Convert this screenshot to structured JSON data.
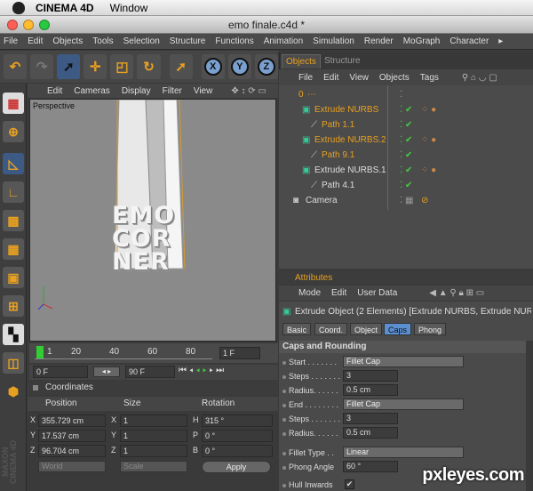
{
  "mac_menu": {
    "app": "CINEMA 4D",
    "items": [
      "Window"
    ]
  },
  "window": {
    "title": "emo finale.c4d *"
  },
  "main_menu": [
    "File",
    "Edit",
    "Objects",
    "Tools",
    "Selection",
    "Structure",
    "Functions",
    "Animation",
    "Simulation",
    "Render",
    "MoGraph",
    "Character"
  ],
  "toolbar": {
    "axis_x": "X",
    "axis_y": "Y",
    "axis_z": "Z"
  },
  "viewport_menu": [
    "Edit",
    "Cameras",
    "Display",
    "Filter",
    "View"
  ],
  "viewport": {
    "label": "Perspective",
    "text_lines": [
      "EMO",
      "COR",
      "NER"
    ]
  },
  "timeline": {
    "ticks": [
      "1",
      "20",
      "40",
      "60",
      "80"
    ],
    "frame_field": "1 F"
  },
  "time_controls": {
    "start": "0 F",
    "end": "90 F"
  },
  "coordinates": {
    "title": "Coordinates",
    "col_position": "Position",
    "col_size": "Size",
    "col_rotation": "Rotation",
    "rows": [
      {
        "axis": "X",
        "pos": "355.729 cm",
        "size_axis": "X",
        "size": "1",
        "rot_axis": "H",
        "rot": "315 °"
      },
      {
        "axis": "Y",
        "pos": "17.537 cm",
        "size_axis": "Y",
        "size": "1",
        "rot_axis": "P",
        "rot": "0 °"
      },
      {
        "axis": "Z",
        "pos": "96.704 cm",
        "size_axis": "Z",
        "size": "1",
        "rot_axis": "B",
        "rot": "0 °"
      }
    ],
    "mode_world": "World",
    "mode_scale": "Scale",
    "apply": "Apply"
  },
  "object_tabs": {
    "objects": "Objects",
    "structure": "Structure"
  },
  "object_menu": [
    "File",
    "Edit",
    "View",
    "Objects",
    "Tags"
  ],
  "objects": [
    {
      "name": "0",
      "color": "#e8a020"
    },
    {
      "name": "Extrude NURBS",
      "color": "#e8a020"
    },
    {
      "name": "Path 1.1",
      "color": "#e8a020"
    },
    {
      "name": "Extrude NURBS.2",
      "color": "#e8a020"
    },
    {
      "name": "Path 9.1",
      "color": "#e8a020"
    },
    {
      "name": "Extrude NURBS.1",
      "color": "#dddddd"
    },
    {
      "name": "Path 4.1",
      "color": "#dddddd"
    },
    {
      "name": "Camera",
      "color": "#dddddd"
    }
  ],
  "attributes": {
    "title": "Attributes",
    "menu": [
      "Mode",
      "Edit",
      "User Data"
    ],
    "object_line": "Extrude Object (2 Elements) [Extrude NURBS, Extrude NURB",
    "tabs": [
      "Basic",
      "Coord.",
      "Object",
      "Caps",
      "Phong"
    ],
    "active_tab": "Caps",
    "section": "Caps and Rounding",
    "params": {
      "start_label": "Start . . . . . . .",
      "start_val": "Fillet Cap",
      "steps1_label": "Steps . . . . . . .",
      "steps1_val": "3",
      "radius1_label": "Radius. . . . . .",
      "radius1_val": "0.5 cm",
      "end_label": "End . . . . . . . .",
      "end_val": "Fillet Cap",
      "steps2_label": "Steps . . . . . . .",
      "steps2_val": "3",
      "radius2_label": "Radius. . . . . .",
      "radius2_val": "0.5 cm",
      "fillet_type_label": "Fillet Type . .",
      "fillet_type_val": "Linear",
      "phong_angle_label": "Phong Angle",
      "phong_angle_val": "60 °",
      "hull_inwards_label": "Hull Inwards",
      "hull_inwards_val": "✔"
    }
  },
  "watermark": "pxleyes.com"
}
